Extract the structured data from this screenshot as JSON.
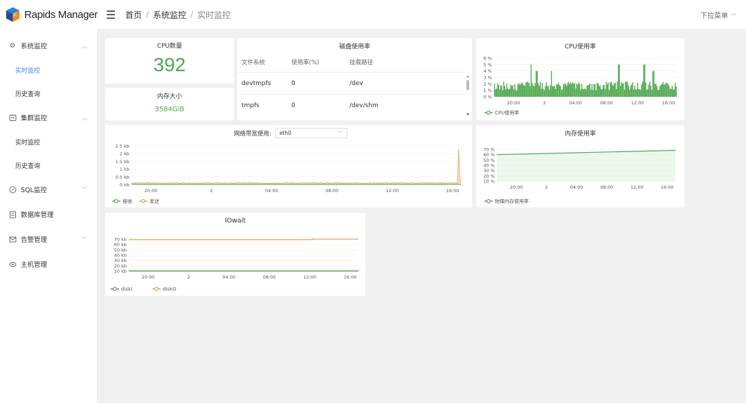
{
  "app": {
    "logo_text": "Rapids Manager"
  },
  "header": {
    "breadcrumb": [
      "首页",
      "系统监控",
      "实时监控"
    ],
    "dropdown_label": "下拉菜单"
  },
  "sidebar": {
    "groups": [
      {
        "label": "系统监控",
        "icon": "gear-icon",
        "expanded": true,
        "children": [
          "实时监控",
          "历史查询"
        ]
      },
      {
        "label": "集群监控",
        "icon": "cluster-icon",
        "expanded": true,
        "children": [
          "实时监控",
          "历史查询"
        ]
      },
      {
        "label": "SQL监控",
        "icon": "sql-icon",
        "expanded": false,
        "children": []
      },
      {
        "label": "数据库管理",
        "icon": "database-icon",
        "expanded": false,
        "children": []
      },
      {
        "label": "告警管理",
        "icon": "mail-icon",
        "expanded": false,
        "children": []
      },
      {
        "label": "主机管理",
        "icon": "eye-icon",
        "expanded": false,
        "children": []
      }
    ],
    "active_item": "实时监控"
  },
  "cpu_count": {
    "title": "CPU数量",
    "value": "392"
  },
  "memory": {
    "title": "内存大小",
    "value": "3584GiB"
  },
  "disk": {
    "title": "磁盘使用率",
    "columns": [
      "文件系统",
      "使用率(%)",
      "挂载路径"
    ],
    "rows": [
      [
        "devtmpfs",
        "0",
        "/dev"
      ],
      [
        "tmpfs",
        "0",
        "/dev/shm"
      ]
    ]
  },
  "network": {
    "title": "网络带宽使用:",
    "selected_interface": "eth0"
  },
  "chart_data": [
    {
      "id": "cpu-usage",
      "type": "bar",
      "title": "CPU使用率",
      "y_ticks": [
        "0 %",
        "1 %",
        "2 %",
        "3 %",
        "4 %",
        "5 %",
        "6 %"
      ],
      "ylim": [
        0,
        6
      ],
      "x_ticks": [
        "20:00",
        "2",
        "04:00",
        "08:00",
        "12:00",
        "16:00"
      ],
      "legend": [
        "CPU使用率"
      ],
      "color": "#4ea84e",
      "baseline": 2,
      "peaks": [
        {
          "x": 0.2,
          "y": 5
        },
        {
          "x": 0.23,
          "y": 4
        },
        {
          "x": 0.31,
          "y": 4
        },
        {
          "x": 0.68,
          "y": 5
        },
        {
          "x": 0.82,
          "y": 5
        },
        {
          "x": 0.87,
          "y": 4
        }
      ]
    },
    {
      "id": "network",
      "type": "area",
      "y_ticks": [
        "0 kb",
        "0.5 kb",
        "1 kb",
        "1.5 kb",
        "2 kb",
        "2.5 kb"
      ],
      "ylim": [
        0,
        2.5
      ],
      "x_ticks": [
        "20:00",
        "2",
        "04:00",
        "08:00",
        "12:00",
        "16:00"
      ],
      "legend": [
        "接收",
        "发送"
      ],
      "colors": [
        "#4ea84e",
        "#f0a050"
      ],
      "series": [
        {
          "name": "接收",
          "values": [
            0.02
          ]
        },
        {
          "name": "发送",
          "baseline": 0.1,
          "spike_end": 2.3
        }
      ]
    },
    {
      "id": "memory-usage",
      "type": "area",
      "title": "内存使用率",
      "y_ticks": [
        "10 %",
        "20 %",
        "30 %",
        "40 %",
        "50 %",
        "60 %",
        "70 %"
      ],
      "ylim": [
        10,
        70
      ],
      "x_ticks": [
        "20:00",
        "2",
        "04:00",
        "08:00",
        "12:00",
        "16:00"
      ],
      "legend": [
        "物理内存使用率"
      ],
      "color": "#4ea84e",
      "series": [
        {
          "name": "物理内存使用率",
          "start": 60,
          "end": 68
        }
      ]
    },
    {
      "id": "iowait",
      "type": "line",
      "title": "IOwait",
      "y_ticks": [
        "10 kb",
        "20 kb",
        "30 kb",
        "40 kb",
        "50 kb",
        "60 kb",
        "70 kb"
      ],
      "ylim": [
        10,
        70
      ],
      "x_ticks": [
        "20:00",
        "2",
        "04:00",
        "08:00",
        "12:00",
        "16:00"
      ],
      "legend": [
        "diskI",
        "diskO"
      ],
      "colors": [
        "#4ea84e",
        "#f0a050"
      ],
      "series": [
        {
          "name": "diskI",
          "values": [
            10
          ]
        },
        {
          "name": "diskO",
          "values": [
            69,
            69,
            70
          ]
        }
      ]
    }
  ]
}
